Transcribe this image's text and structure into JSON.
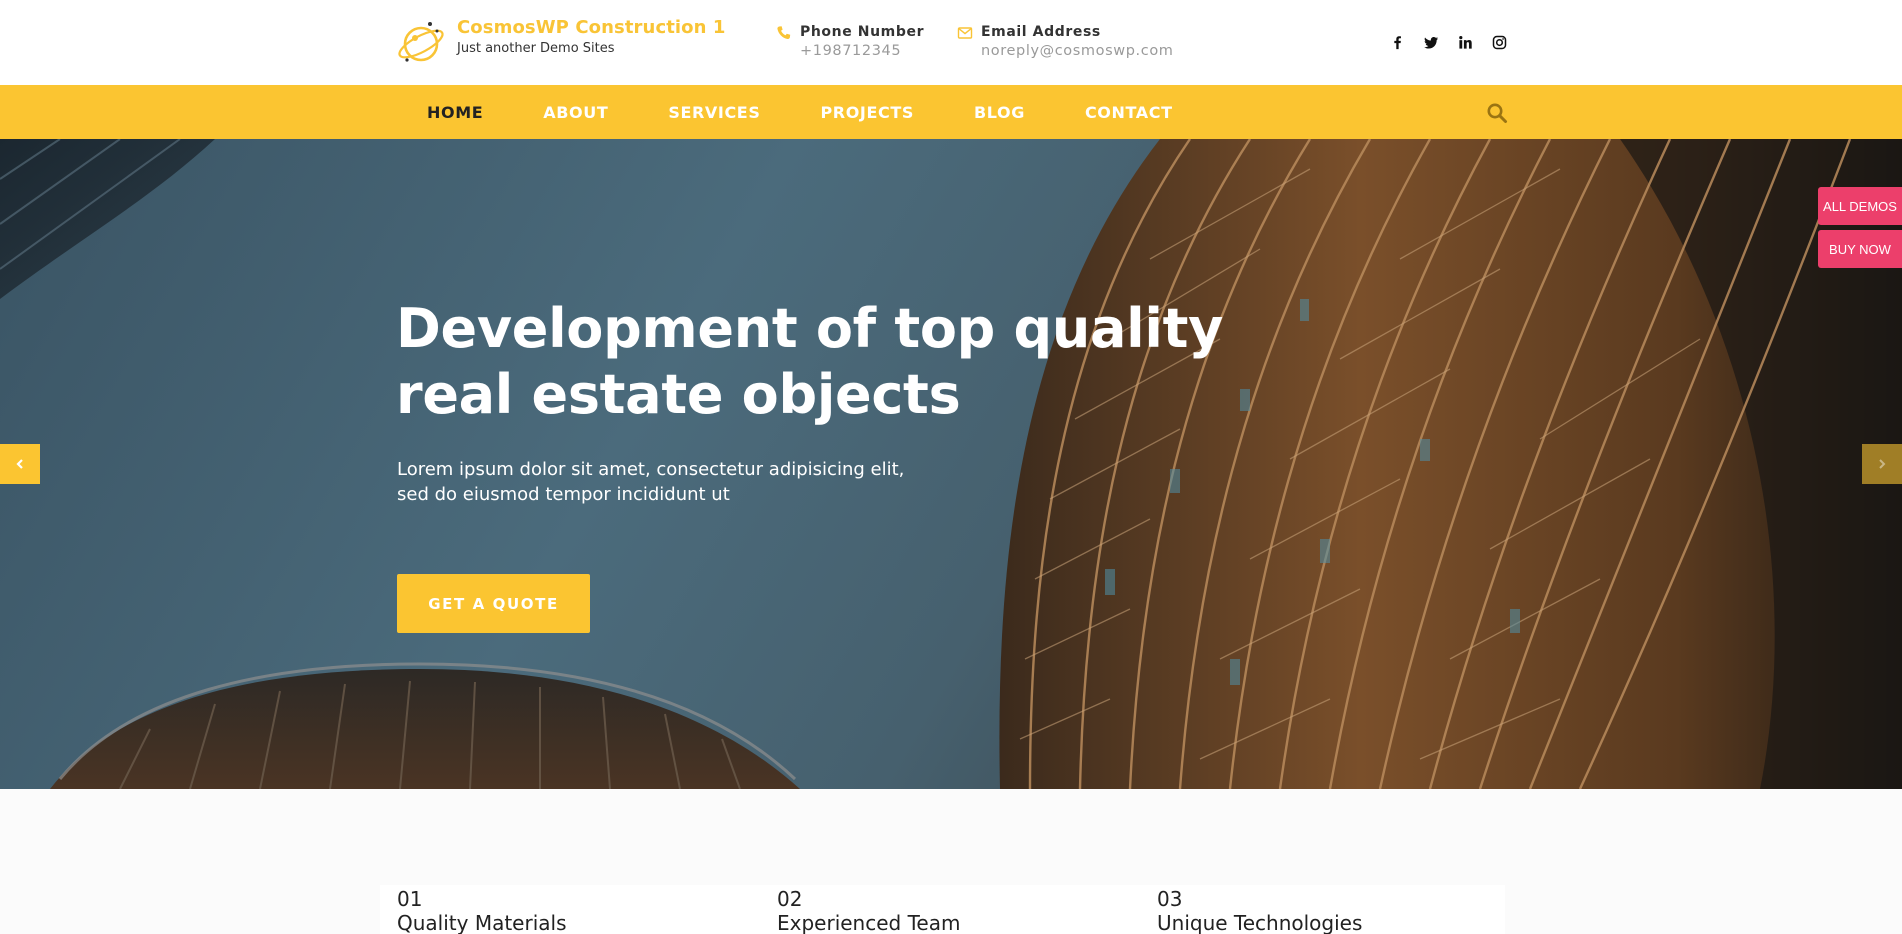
{
  "brand": {
    "title": "CosmosWP Construction 1",
    "tagline": "Just another Demo Sites"
  },
  "contact": {
    "phone_label": "Phone Number",
    "phone_value": "+198712345",
    "email_label": "Email Address",
    "email_value": "noreply@cosmoswp.com"
  },
  "socials": [
    {
      "icon": "facebook-icon"
    },
    {
      "icon": "twitter-icon"
    },
    {
      "icon": "linkedin-icon"
    },
    {
      "icon": "instagram-icon"
    }
  ],
  "nav": {
    "items": [
      {
        "label": "HOME",
        "active": true
      },
      {
        "label": "ABOUT"
      },
      {
        "label": "SERVICES"
      },
      {
        "label": "PROJECTS"
      },
      {
        "label": "BLOG"
      },
      {
        "label": "CONTACT"
      }
    ],
    "search_icon": "search-icon"
  },
  "hero": {
    "title_line1": "Development of top quality",
    "title_line2": "real estate objects",
    "subtitle_line1": "Lorem ipsum dolor sit amet, consectetur adipisicing elit,",
    "subtitle_line2": "sed do eiusmod tempor incididunt ut",
    "cta_label": "GET A QUOTE"
  },
  "side_buttons": {
    "all_demos": "ALL DEMOS",
    "buy_now": "BUY NOW"
  },
  "features": [
    {
      "number": "01",
      "title": "Quality Materials"
    },
    {
      "number": "02",
      "title": "Experienced Team"
    },
    {
      "number": "03",
      "title": "Unique Technologies"
    }
  ],
  "colors": {
    "accent": "#fbc531",
    "brand_title": "#f9c436",
    "side_button": "#ec3f6b"
  }
}
